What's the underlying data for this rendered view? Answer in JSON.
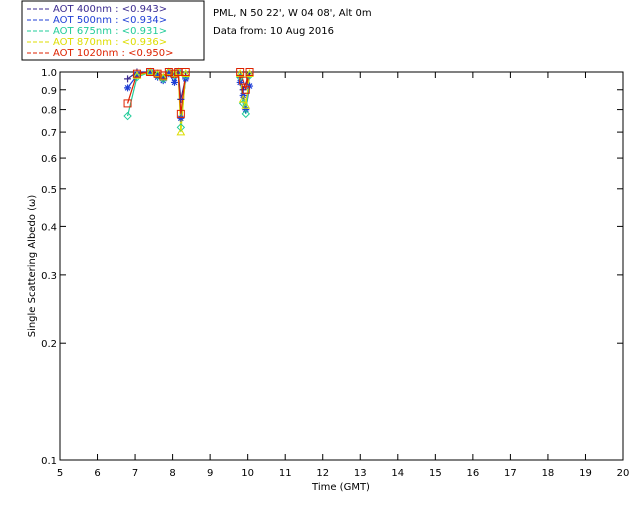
{
  "header": {
    "location": "PML, N 50 22', W 04 08', Alt 0m",
    "date_line": "Data from: 10 Aug 2016"
  },
  "chart_data": {
    "type": "line",
    "xlabel": "Time (GMT)",
    "ylabel": "Single Scattering Albedo (ω)",
    "xlim": [
      5,
      20
    ],
    "ylim": [
      0.1,
      1.0
    ],
    "y_scale": "log",
    "grid": false,
    "legend_position": "top-left, outside plot",
    "x_ticks": [
      5,
      6,
      7,
      8,
      9,
      10,
      11,
      12,
      13,
      14,
      15,
      16,
      17,
      18,
      19,
      20
    ],
    "x_tick_labels": [
      "5",
      "6",
      "7",
      "8",
      "9",
      "10",
      "11",
      "12",
      "13",
      "14",
      "15",
      "16",
      "17",
      "18",
      "19",
      "20"
    ],
    "y_ticks": [
      0.1,
      0.2,
      0.3,
      0.4,
      0.5,
      0.6,
      0.7,
      0.8,
      0.9,
      1.0
    ],
    "y_tick_labels": [
      "0.1",
      "0.2",
      "0.3",
      "0.4",
      "0.5",
      "0.6",
      "0.7",
      "0.8",
      "0.9",
      "1.0"
    ],
    "series": [
      {
        "name": "AOT  400nm : <0.943>",
        "color": "#3b2a8f",
        "marker": "plus",
        "x": [
          6.8,
          7.05,
          7.4,
          7.6,
          7.75,
          7.9,
          8.05,
          8.15,
          8.22,
          8.35,
          9.8,
          9.88,
          10.05
        ],
        "y": [
          0.96,
          1.0,
          1.0,
          0.99,
          0.97,
          1.0,
          0.99,
          1.0,
          0.85,
          0.97,
          0.97,
          0.9,
          0.99
        ]
      },
      {
        "name": "AOT  500nm : <0.934>",
        "color": "#1f3fd6",
        "marker": "asterisk",
        "x": [
          6.8,
          7.05,
          7.4,
          7.6,
          7.75,
          7.9,
          8.05,
          8.15,
          8.22,
          8.35,
          9.8,
          9.88,
          9.95,
          10.05
        ],
        "y": [
          0.91,
          0.98,
          1.0,
          0.97,
          0.95,
          0.99,
          0.94,
          1.0,
          0.76,
          0.96,
          0.94,
          0.87,
          0.8,
          0.92
        ]
      },
      {
        "name": "AOT  675nm : <0.931>",
        "color": "#22cc99",
        "marker": "diamond",
        "x": [
          6.8,
          7.05,
          7.4,
          7.6,
          7.75,
          7.9,
          8.05,
          8.15,
          8.22,
          8.35,
          9.8,
          9.88,
          9.95,
          10.05
        ],
        "y": [
          0.77,
          0.97,
          1.0,
          0.98,
          0.96,
          1.0,
          0.98,
          1.0,
          0.72,
          0.98,
          0.97,
          0.83,
          0.78,
          0.98
        ]
      },
      {
        "name": "AOT  870nm : <0.936>",
        "color": "#dddd00",
        "marker": "triangle",
        "x": [
          7.05,
          7.4,
          7.6,
          7.75,
          7.9,
          8.05,
          8.15,
          8.22,
          8.35,
          9.8,
          9.88,
          9.95,
          10.05
        ],
        "y": [
          0.98,
          1.0,
          0.99,
          0.97,
          1.0,
          0.99,
          1.0,
          0.7,
          0.99,
          0.99,
          0.85,
          0.82,
          0.99
        ]
      },
      {
        "name": "AOT 1020nm : <0.950>",
        "color": "#dd2200",
        "marker": "square",
        "x": [
          6.8,
          7.05,
          7.4,
          7.6,
          7.75,
          7.9,
          8.05,
          8.15,
          8.22,
          8.35,
          9.8,
          9.88,
          9.95,
          10.05
        ],
        "y": [
          0.83,
          0.99,
          1.0,
          0.99,
          0.98,
          1.0,
          0.99,
          1.0,
          0.78,
          1.0,
          1.0,
          0.95,
          0.9,
          1.0
        ]
      }
    ]
  }
}
